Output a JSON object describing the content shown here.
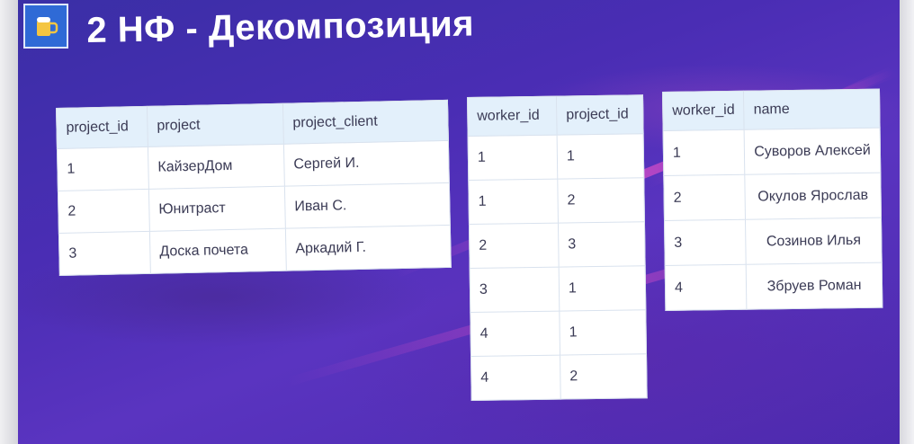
{
  "slide": {
    "title": "2 НФ - Декомпозиция",
    "logo_icon": "beer-mug-icon"
  },
  "projects_table": {
    "headers": [
      "project_id",
      "project",
      "project_client"
    ],
    "rows": [
      [
        "1",
        "КайзерДом",
        "Сергей И."
      ],
      [
        "2",
        "Юнитраст",
        "Иван С."
      ],
      [
        "3",
        "Доска почета",
        "Аркадий Г."
      ]
    ]
  },
  "worker_projects_table": {
    "headers": [
      "worker_id",
      "project_id"
    ],
    "rows": [
      [
        "1",
        "1"
      ],
      [
        "1",
        "2"
      ],
      [
        "2",
        "3"
      ],
      [
        "3",
        "1"
      ],
      [
        "4",
        "1"
      ],
      [
        "4",
        "2"
      ]
    ]
  },
  "workers_table": {
    "headers": [
      "worker_id",
      "name"
    ],
    "rows": [
      [
        "1",
        "Суворов Алексей"
      ],
      [
        "2",
        "Окулов Ярослав"
      ],
      [
        "3",
        "Созинов Илья"
      ],
      [
        "4",
        "Збруев Роман"
      ]
    ]
  },
  "colors": {
    "background": "#4a2db4",
    "header_fill": "#e3f0fb",
    "title_text": "#ffffff"
  }
}
